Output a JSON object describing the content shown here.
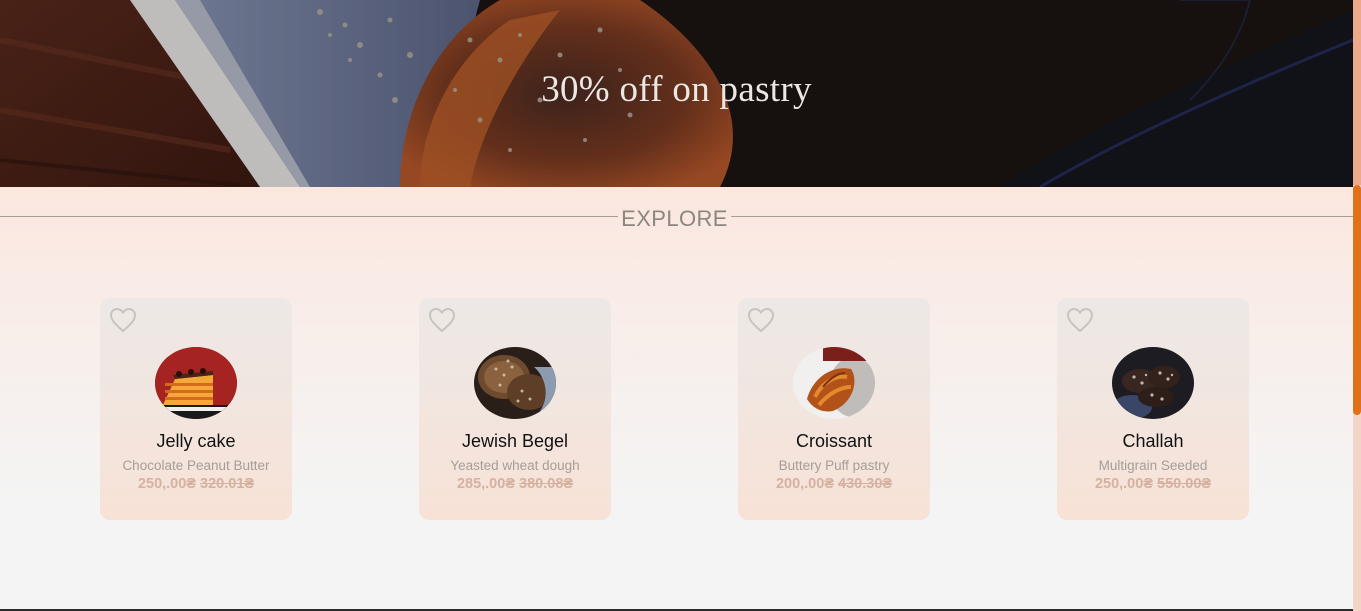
{
  "hero": {
    "title": "30% off on pastry"
  },
  "explore": {
    "title": "EXPLORE"
  },
  "products": [
    {
      "name": "Jelly cake",
      "description": "Chocolate Peanut Butter",
      "price": "250,.00₴",
      "old_price": "320.01₴"
    },
    {
      "name": "Jewish Begel",
      "description": "Yeasted wheat dough",
      "price": "285,.00₴",
      "old_price": "380.08₴"
    },
    {
      "name": "Croissant",
      "description": "Buttery Puff pastry",
      "price": "200,.00₴",
      "old_price": "430.30₴"
    },
    {
      "name": "Challah",
      "description": "Multigrain Seeded",
      "price": "250,.00₴",
      "old_price": "550.00₴"
    }
  ],
  "icons": {
    "favorite": "heart-outline-icon"
  },
  "colors": {
    "accent": "#e07118",
    "section_bg": "#fbe7de",
    "price": "#d5b1a0"
  }
}
